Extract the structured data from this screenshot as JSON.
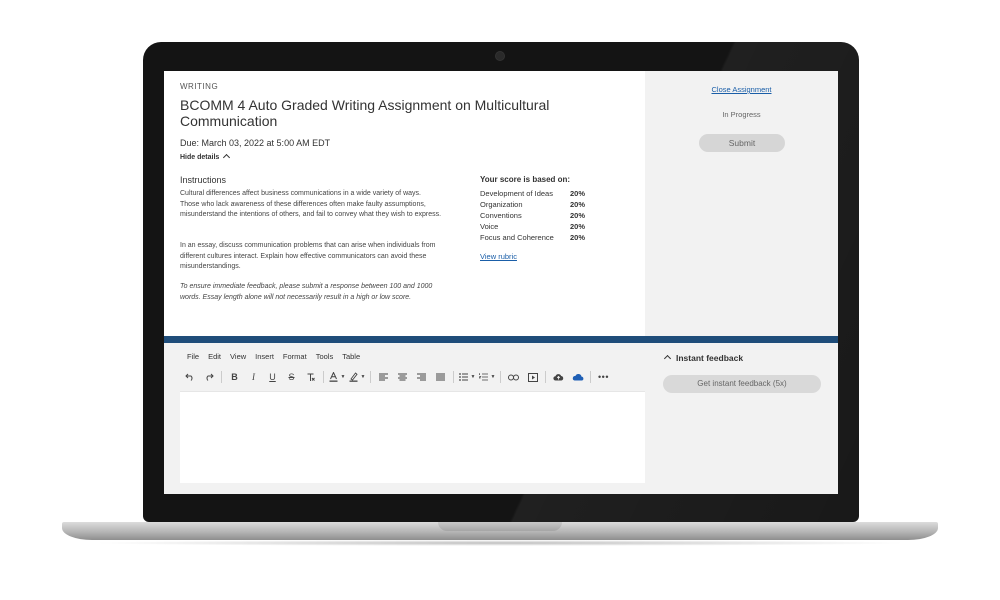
{
  "assignment": {
    "category": "WRITING",
    "title": "BCOMM 4 Auto Graded Writing Assignment on Multicultural Communication",
    "due": "Due: March 03, 2022 at 5:00 AM EDT",
    "hide_details": "Hide details"
  },
  "instructions": {
    "heading": "Instructions",
    "paragraphs": [
      "Cultural differences affect business communications in a wide variety of ways. Those who lack awareness of these differences often make faulty assumptions, misunderstand the intentions of others, and fail to convey what they wish to express.",
      "In an essay, discuss communication problems that can arise when individuals from different cultures interact. Explain how effective communicators can avoid these misunderstandings.",
      "To ensure immediate feedback, please submit a response between 100 and 1000 words. Essay length alone will not necessarily result in a high or low score."
    ]
  },
  "score": {
    "heading": "Your score is based on:",
    "criteria": [
      {
        "name": "Development of Ideas",
        "weight": "20%"
      },
      {
        "name": "Organization",
        "weight": "20%"
      },
      {
        "name": "Conventions",
        "weight": "20%"
      },
      {
        "name": "Voice",
        "weight": "20%"
      },
      {
        "name": "Focus and Coherence",
        "weight": "20%"
      }
    ],
    "rubric_link": "View rubric"
  },
  "sidebar": {
    "close_link": "Close Assignment",
    "status": "In Progress",
    "submit_label": "Submit"
  },
  "editor": {
    "menu": [
      "File",
      "Edit",
      "View",
      "Insert",
      "Format",
      "Tools",
      "Table"
    ],
    "toolbar_icons": [
      "undo-icon",
      "redo-icon",
      "bold-icon",
      "italic-icon",
      "underline-icon",
      "strikethrough-icon",
      "clear-format-icon",
      "text-color-icon",
      "highlight-icon",
      "align-left-icon",
      "align-center-icon",
      "align-right-icon",
      "justify-icon",
      "bullet-list-icon",
      "numbered-list-icon",
      "link-icon",
      "media-icon",
      "cloud-upload-icon",
      "onedrive-icon",
      "more-icon"
    ]
  },
  "feedback": {
    "heading": "Instant feedback",
    "button_label": "Get instant feedback (5x)"
  },
  "colors": {
    "accent_bar": "#1f4d7a",
    "link": "#1a5ea8",
    "panel_bg": "#f2f2f2"
  }
}
